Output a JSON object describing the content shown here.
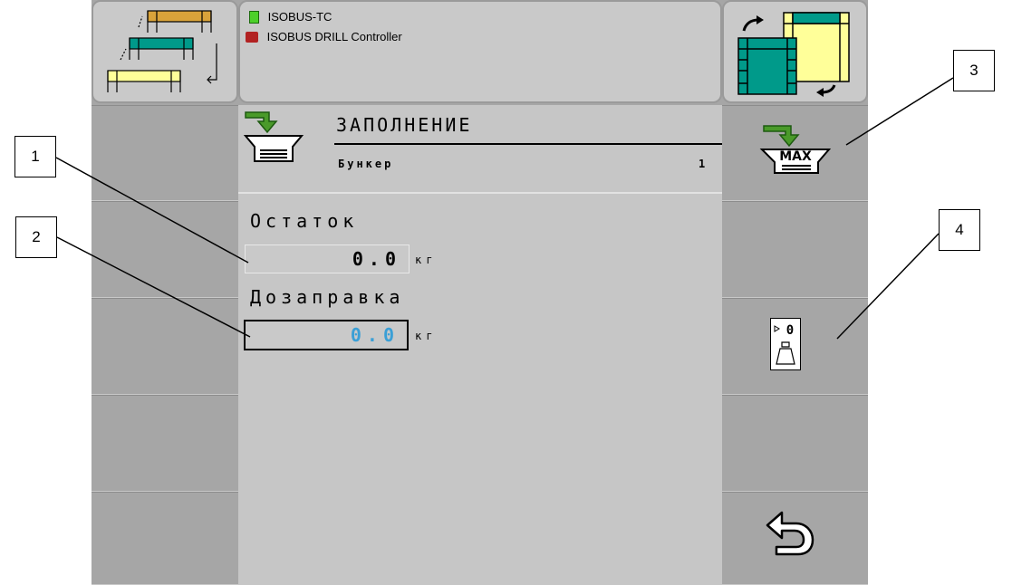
{
  "header": {
    "task_controller": "ISOBUS-TC",
    "implement": "ISOBUS DRILL Controller"
  },
  "page": {
    "title": "ЗАПОЛНЕНИЕ",
    "subtitle_label": "Бункер",
    "subtitle_value": "1"
  },
  "fields": {
    "remaining_label": "Остаток",
    "remaining_value": "0.0",
    "remaining_unit": "кг",
    "refill_label": "Дозаправка",
    "refill_value": "0.0",
    "refill_unit": "кг"
  },
  "softkeys": {
    "fill_max_text": "MAX",
    "tare_text": "0"
  },
  "callouts": [
    "1",
    "2",
    "3",
    "4"
  ],
  "colors": {
    "active_value": "#3a9fd6",
    "green_arrow": "#4a9a2a",
    "teal": "#009a8a",
    "yellow": "#ffff99",
    "orange": "#d9a33a"
  }
}
